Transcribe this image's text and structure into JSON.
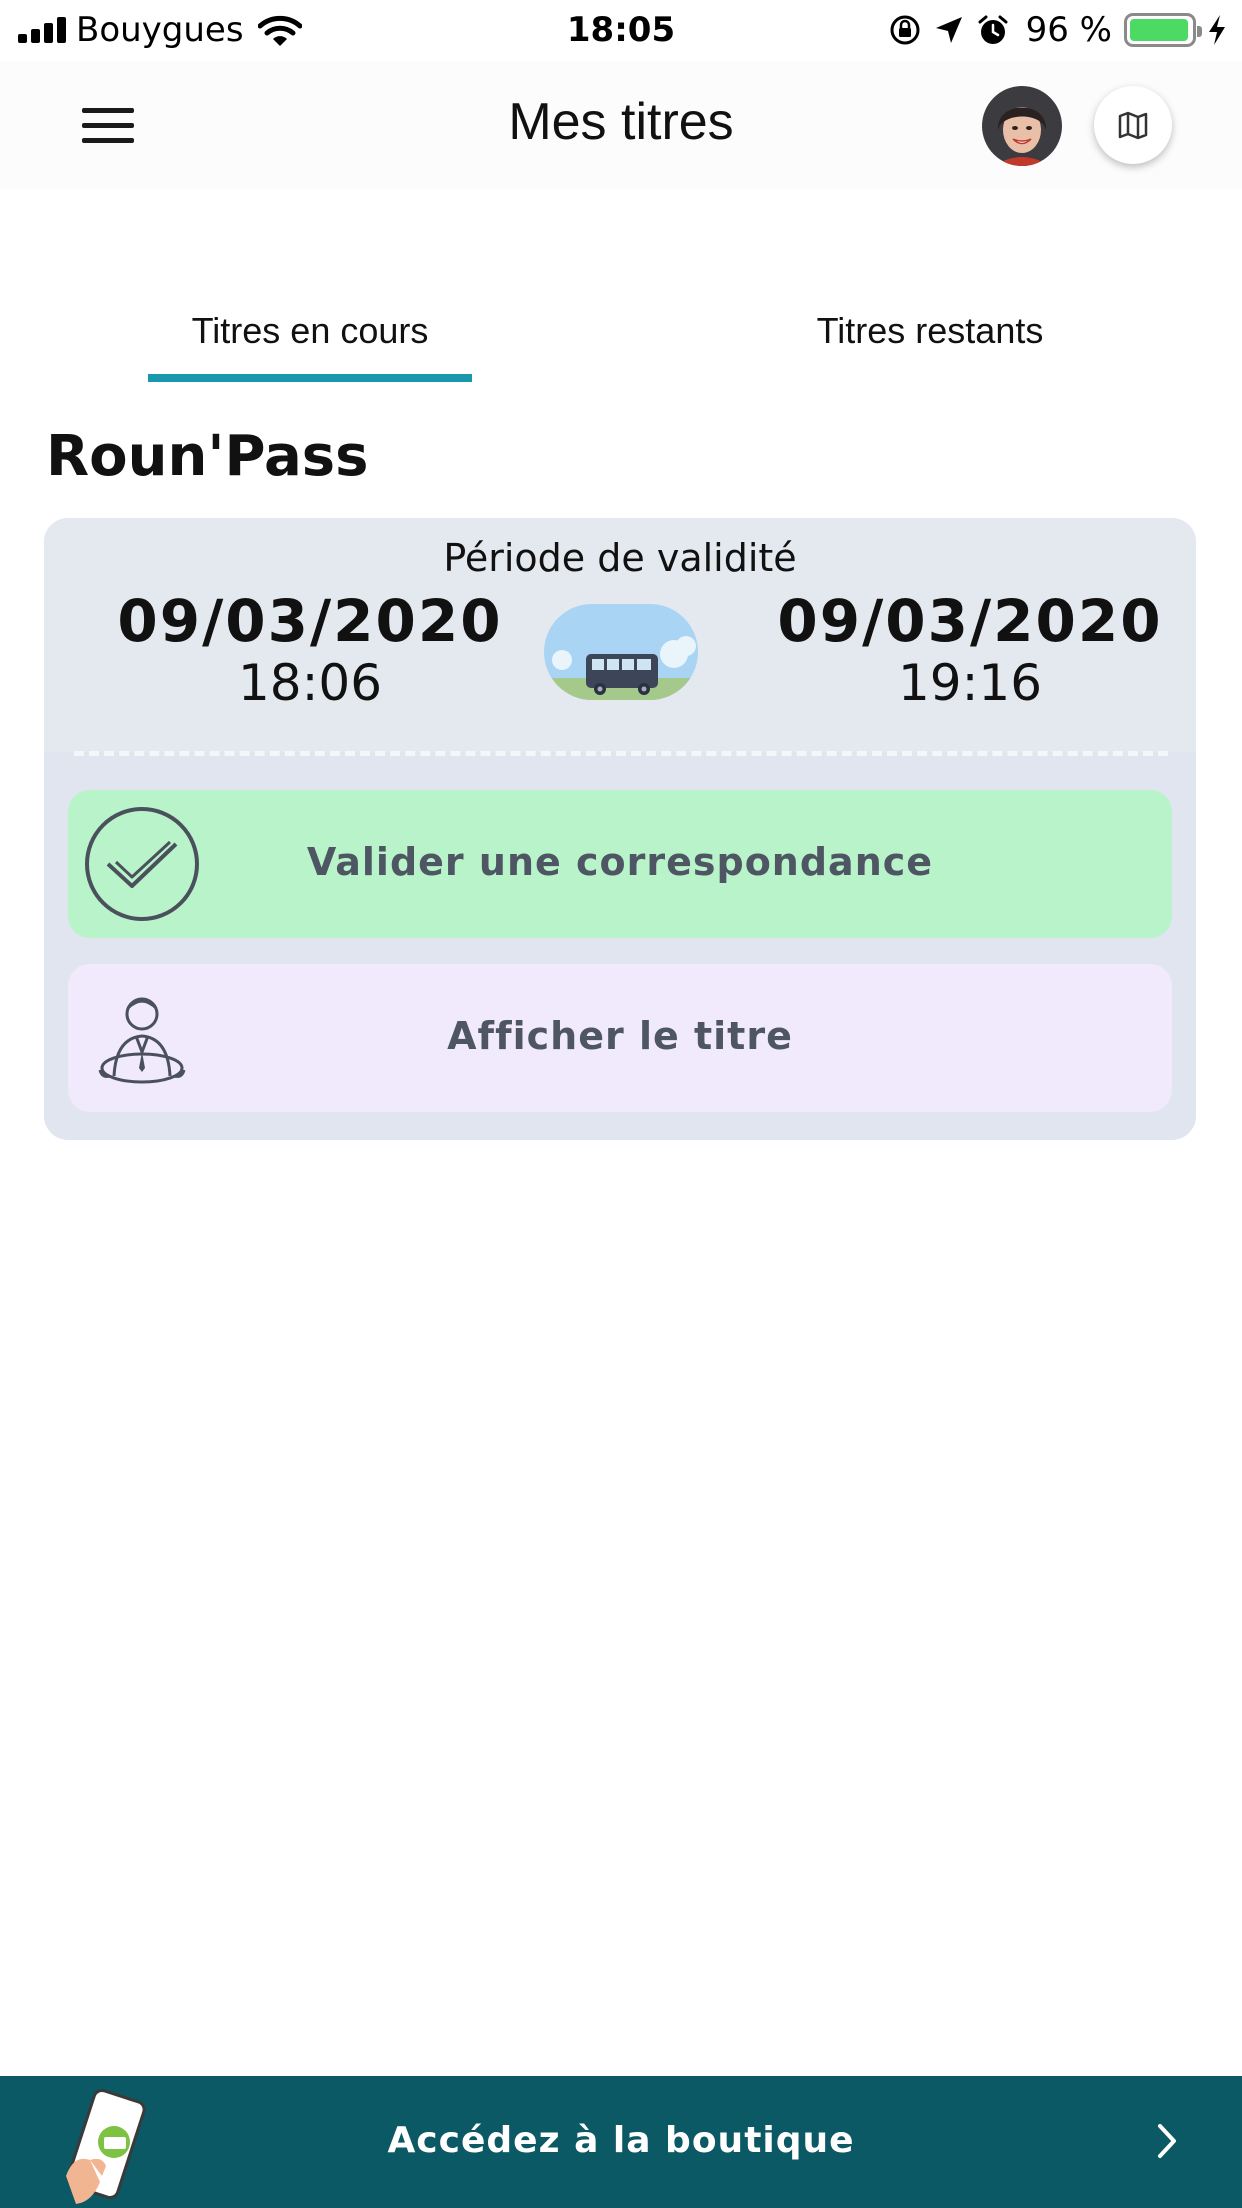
{
  "status_bar": {
    "carrier": "Bouygues",
    "time": "18:05",
    "battery_percent": "96 %",
    "battery_level": 0.96,
    "icons": [
      "signal-icon",
      "wifi-icon",
      "rotation-lock-icon",
      "location-arrow-icon",
      "alarm-icon",
      "battery-icon",
      "charging-bolt-icon"
    ]
  },
  "nav": {
    "title": "Mes titres",
    "icons": [
      "menu-icon",
      "avatar",
      "map-icon"
    ]
  },
  "tabs": [
    {
      "label": "Titres en cours",
      "active": true
    },
    {
      "label": "Titres restants",
      "active": false
    }
  ],
  "section": {
    "title": "Roun'Pass"
  },
  "ticket": {
    "validity_label": "Période de validité",
    "start": {
      "date": "09/03/2020",
      "time": "18:06"
    },
    "end": {
      "date": "09/03/2020",
      "time": "19:16"
    },
    "icon": "bus-icon",
    "actions": [
      {
        "label": "Valider une correspondance",
        "icon": "checkmark-circle-icon",
        "color": "#b9f3c9"
      },
      {
        "label": "Afficher le titre",
        "icon": "driver-icon",
        "color": "#f1eafc"
      }
    ]
  },
  "shop_banner": {
    "label": "Accédez à la boutique",
    "icon": "phone-ticket-icon",
    "chevron": "chevron-right-icon",
    "color": "#0a5964"
  },
  "colors": {
    "accent": "#1897ad",
    "ticket_bg": "#e0e5ef",
    "action_text": "#4e5563"
  }
}
